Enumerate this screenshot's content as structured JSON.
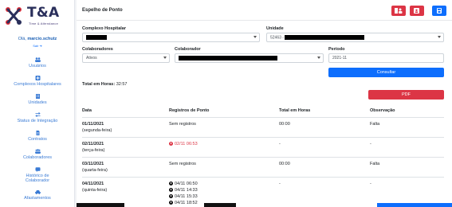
{
  "brand": {
    "name": "T&A",
    "tagline": "Time & Attendance",
    "colors": {
      "primary": "#2a2f5b",
      "accent": "#e0303a"
    }
  },
  "user": {
    "greeting_prefix": "Olá, ",
    "username": "marcio.schutz",
    "logout_label": "Sair"
  },
  "sidebar": {
    "items": [
      {
        "label": "Usuários",
        "icon": "users-icon"
      },
      {
        "label": "Complexos Hospitalares",
        "icon": "hospital-icon"
      },
      {
        "label": "Unidades",
        "icon": "building-icon"
      },
      {
        "label": "Status de Integração",
        "icon": "exchange-icon"
      },
      {
        "label": "Contratos",
        "icon": "document-icon"
      },
      {
        "label": "Colaboradores",
        "icon": "people-icon"
      },
      {
        "label": "Histórico de",
        "label2": "Colaborador",
        "icon": "history-icon"
      },
      {
        "label": "Afastamentos",
        "icon": "car-icon"
      }
    ]
  },
  "header": {
    "title": "Espelho de Ponto",
    "colors": {
      "danger": "#dc3545",
      "primary": "#0d6efd"
    }
  },
  "filters": {
    "complexo_label": "Complexo Hospitalar",
    "unidade_label": "Unidade",
    "unidade_value_prefix": "52463 -",
    "colaboradores_label": "Colaboradores",
    "colaboradores_value": "Ativos",
    "colaborador_label": "Colaborador",
    "periodo_label": "Período",
    "periodo_value": "2021-11",
    "consultar_label": "Consultar"
  },
  "summary": {
    "total_label": "Total em Horas:",
    "total_value": "32:57"
  },
  "pdf_label": "PDF",
  "table": {
    "headers": [
      "Data",
      "Registros de Ponto",
      "Total em Horas",
      "Observação"
    ],
    "rows": [
      {
        "date": "01/11/2021",
        "weekday": "(segunda-feira)",
        "records": [
          "Sem registros"
        ],
        "total": "00:00",
        "obs": "Falta"
      },
      {
        "date": "02/11/2021",
        "weekday": "(terça-feira)",
        "records": [
          "02/11 06:53"
        ],
        "total": "-",
        "obs": "-"
      },
      {
        "date": "03/11/2021",
        "weekday": "(quarta-feira)",
        "records": [
          "Sem registros"
        ],
        "total": "00:00",
        "obs": "Falta"
      },
      {
        "date": "04/11/2021",
        "weekday": "(quinta-feira)",
        "records": [
          "04/11 06:50",
          "04/11 14:33",
          "04/11 15:33",
          "04/11 18:52"
        ],
        "total": "-",
        "obs": "-"
      }
    ]
  }
}
